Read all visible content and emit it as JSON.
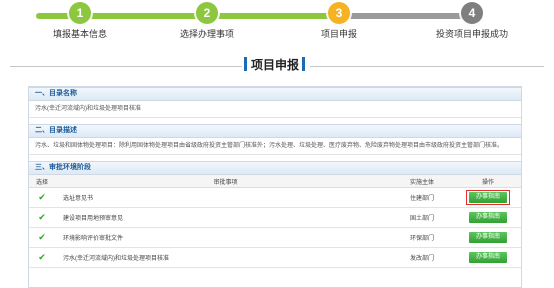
{
  "steps": [
    {
      "num": "1",
      "label": "填报基本信息",
      "color": "#8dc63f",
      "state": "done"
    },
    {
      "num": "2",
      "label": "选择办理事项",
      "color": "#8dc63f",
      "state": "done"
    },
    {
      "num": "3",
      "label": "项目申报",
      "color": "#f5b324",
      "state": "current"
    },
    {
      "num": "4",
      "label": "投资项目申报成功",
      "color": "#7f7f7f",
      "state": "todo"
    }
  ],
  "colors": {
    "done": "#8dc63f",
    "current": "#f5b324",
    "todo": "#9a9a9a",
    "accent": "#1c6bb5",
    "button": "#33a033",
    "highlight": "#e03030"
  },
  "page_title": "项目申报",
  "sections": {
    "catalog_name": {
      "heading": "一、目录名称",
      "text": "污水(幸迁河流域内)和垃圾处理项目核准"
    },
    "catalog_desc": {
      "heading": "二、目录描述",
      "text": "污水、垃圾和固体物处理项目：除利用固体物处理项目由省级政府投资主管部门核准外；污水处理、垃圾处理、医疗废弃物、危险废弃物处理项目由市级政府投资主管部门核准。"
    },
    "approval": {
      "heading": "三、审批环境阶段"
    }
  },
  "table": {
    "headers": {
      "select": "选择",
      "item": "审批事项",
      "dept": "实施主体",
      "op": "操作"
    },
    "rows": [
      {
        "item": "选址意见书",
        "dept": "住建部门",
        "op": "办事指南",
        "highlighted": true
      },
      {
        "item": "建设项目用地预审意见",
        "dept": "国土部门",
        "op": "办事指南",
        "highlighted": false
      },
      {
        "item": "环境影响评价审批文件",
        "dept": "环保部门",
        "op": "办事指南",
        "highlighted": false
      },
      {
        "item": "污水(幸迁河流域内)和垃圾处理项目核准",
        "dept": "发改部门",
        "op": "办事指南",
        "highlighted": false
      }
    ]
  },
  "icons": {
    "check": "check-icon"
  }
}
